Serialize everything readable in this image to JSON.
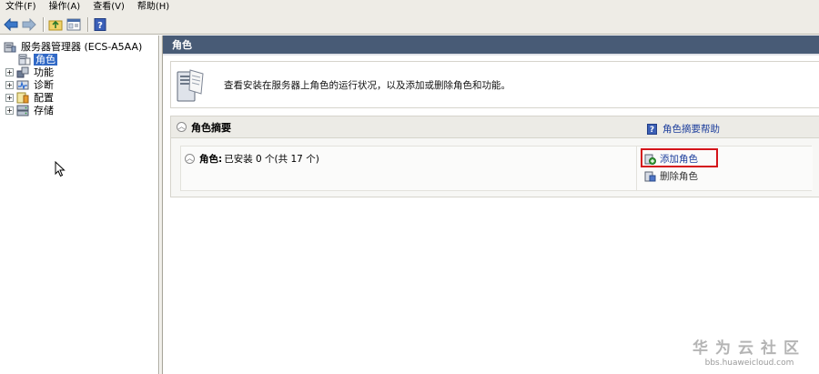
{
  "menu": [
    {
      "label": "文件(F)"
    },
    {
      "label": "操作(A)"
    },
    {
      "label": "查看(V)"
    },
    {
      "label": "帮助(H)"
    }
  ],
  "tree": {
    "root_label": "服务器管理器 (ECS-A5AA)",
    "items": [
      {
        "label": "角色",
        "selected": true,
        "icon": "roles-icon"
      },
      {
        "label": "功能",
        "expander": "+",
        "icon": "features-icon"
      },
      {
        "label": "诊断",
        "expander": "+",
        "icon": "diagnostics-icon"
      },
      {
        "label": "配置",
        "expander": "+",
        "icon": "configuration-icon"
      },
      {
        "label": "存储",
        "expander": "+",
        "icon": "storage-icon"
      }
    ]
  },
  "content": {
    "header": "角色",
    "intro_text": "查看安装在服务器上角色的运行状况，以及添加或删除角色和功能。",
    "summary": {
      "title": "角色摘要",
      "help_link": "角色摘要帮助",
      "roles_label": "角色:",
      "roles_value": "已安装 0 个(共 17 个)",
      "add_roles": "添加角色",
      "remove_roles": "删除角色"
    }
  },
  "watermark": {
    "line1": "华为云社区",
    "line2": "bbs.huaweicloud.com"
  },
  "colors": {
    "header_bg": "#485b76",
    "selection": "#3169c6",
    "link": "#1c3e9c",
    "highlight_box": "#d4141a"
  }
}
